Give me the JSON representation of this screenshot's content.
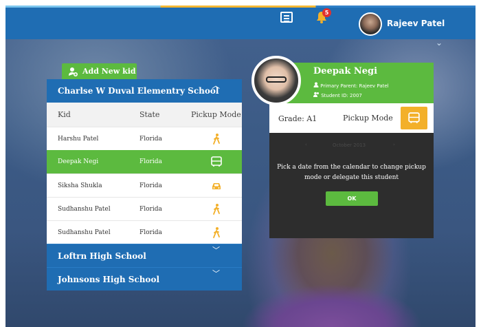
{
  "header": {
    "user_name": "Rajeev Patel",
    "notification_count": "5"
  },
  "add_kid_label": "Add New kid",
  "schools": [
    {
      "name": "Charlse W Duval Elementry School",
      "expanded": true,
      "columns": [
        "Kid",
        "State",
        "Pickup Mode"
      ],
      "rows": [
        {
          "kid": "Harshu Patel",
          "state": "Florida",
          "mode": "walk"
        },
        {
          "kid": "Deepak Negi",
          "state": "Florida",
          "mode": "bus",
          "selected": true
        },
        {
          "kid": "Siksha Shukla",
          "state": "Florida",
          "mode": "car"
        },
        {
          "kid": "Sudhanshu Patel",
          "state": "Florida",
          "mode": "walk"
        },
        {
          "kid": "Sudhanshu Patel",
          "state": "Florida",
          "mode": "walk"
        }
      ]
    },
    {
      "name": "Loftrn High School",
      "expanded": false
    },
    {
      "name": "Johnsons High School",
      "expanded": false
    }
  ],
  "student": {
    "name": "Deepak Negi",
    "primary_parent": "Primary Parent: Rajeev Patel",
    "student_id": "Student ID: 2007",
    "grade": "Grade: A1",
    "pickup_mode_label": "Pickup Mode"
  },
  "calendar": {
    "month": "October 2013",
    "message": "Pick a date from the calendar to change pickup mode or delegate this student",
    "ok_label": "OK"
  },
  "colors": {
    "primary_blue": "#1f6db3",
    "green": "#5cba3f",
    "amber": "#f3b02a",
    "dark": "#2d2d2d"
  }
}
